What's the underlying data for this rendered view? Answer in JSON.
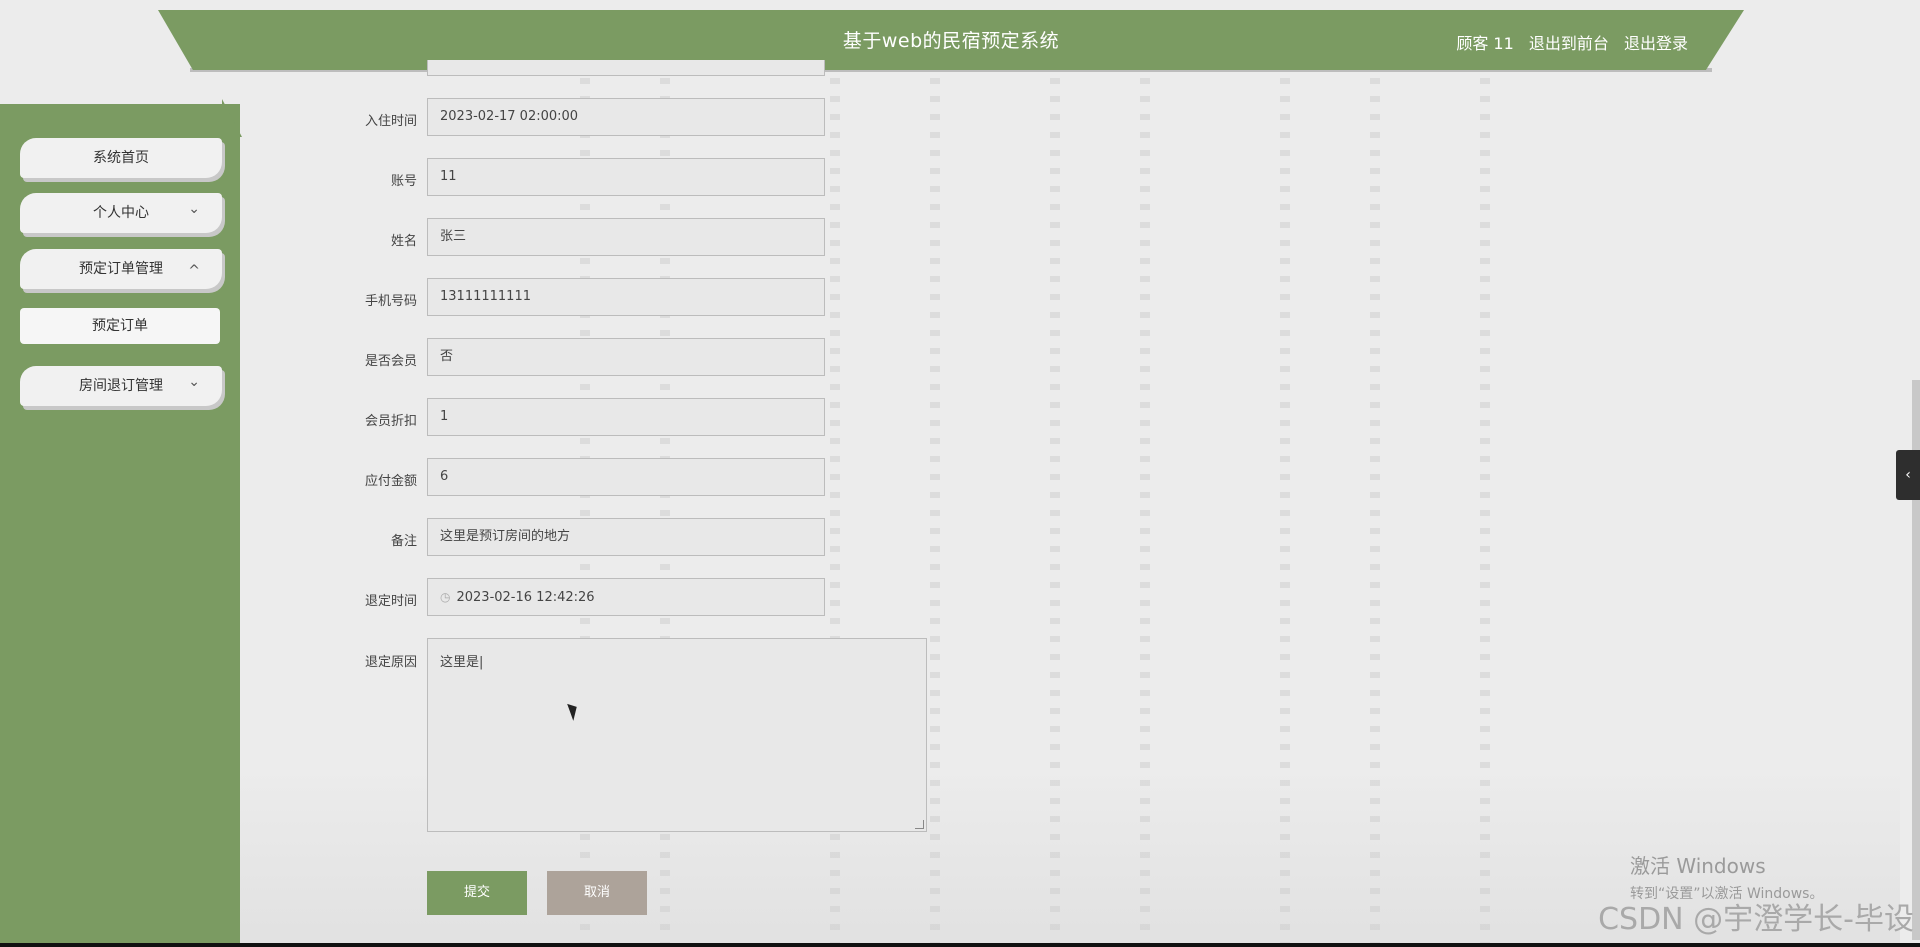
{
  "header": {
    "title": "基于web的民宿预定系统",
    "user": "顾客 11",
    "back_to_front": "退出到前台",
    "logout": "退出登录",
    "bg_color": "#7b9b62"
  },
  "sidebar": {
    "items": [
      {
        "label": "系统首页"
      },
      {
        "label": "个人中心",
        "chevron": "⌄"
      },
      {
        "label": "预定订单管理",
        "chevron": "^"
      },
      {
        "label": "预定订单"
      },
      {
        "label": "房间退订管理",
        "chevron": "⌄"
      }
    ]
  },
  "form": {
    "fields": [
      {
        "label": "入住时间",
        "value": "2023-02-17 02:00:00"
      },
      {
        "label": "账号",
        "value": "11"
      },
      {
        "label": "姓名",
        "value": "张三"
      },
      {
        "label": "手机号码",
        "value": "13111111111"
      },
      {
        "label": "是否会员",
        "value": "否"
      },
      {
        "label": "会员折扣",
        "value": "1"
      },
      {
        "label": "应付金额",
        "value": "6"
      },
      {
        "label": "备注",
        "value": "这里是预订房间的地方"
      },
      {
        "label": "退定时间",
        "value": "2023-02-16 12:42:26"
      }
    ],
    "reason_label": "退定原因",
    "reason_value": "这里是|",
    "submit_label": "提交",
    "cancel_label": "取消",
    "submit_color": "#7b9b62",
    "cancel_color": "#ada39a"
  },
  "toggle": {
    "icon": "‹"
  },
  "watermark": {
    "line1": "激活 Windows",
    "line2": "转到“设置”以激活 Windows。",
    "csdn": "CSDN @宇澄学长-毕设"
  }
}
